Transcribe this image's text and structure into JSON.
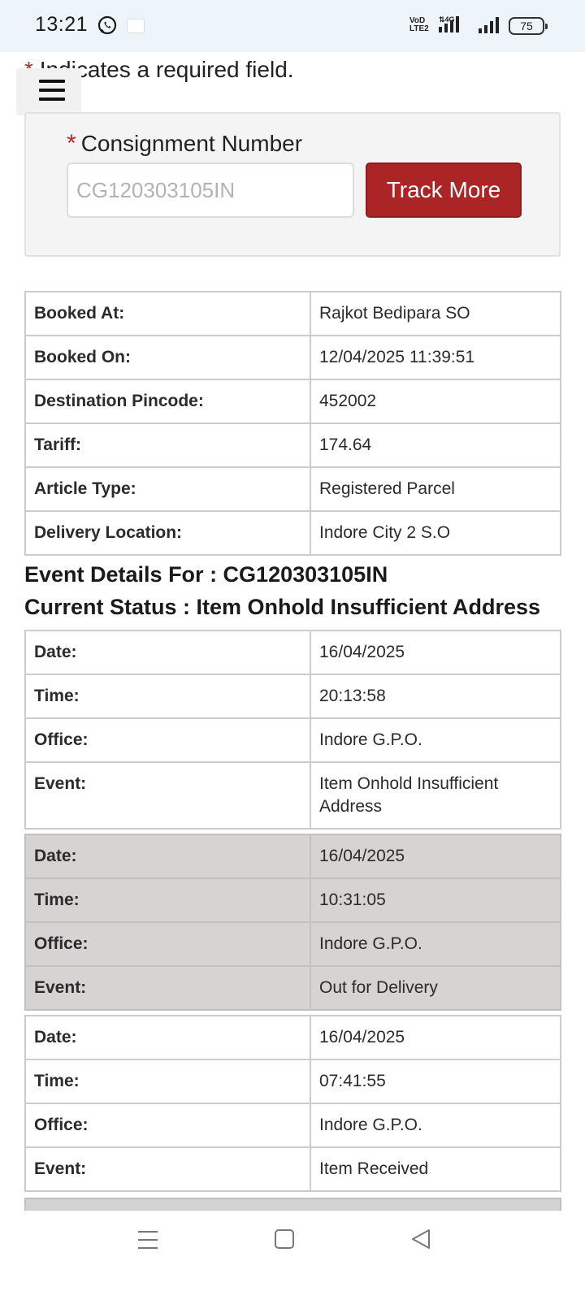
{
  "status_bar": {
    "time": "13:21",
    "network": "VoLTE",
    "battery": "75",
    "icons": [
      "whatsapp-icon",
      "app-notification-icon",
      "volte-icon",
      "4g-signal-icon",
      "signal-icon",
      "battery-icon"
    ]
  },
  "form": {
    "required_star": "*",
    "required_note": "Indicates a required field.",
    "label": "Consignment Number",
    "input_value": "",
    "input_placeholder": "CG120303105IN",
    "button_label": "Track More"
  },
  "booking": {
    "rows": [
      {
        "label": "Booked At:",
        "value": "Rajkot Bedipara SO"
      },
      {
        "label": "Booked On:",
        "value": "12/04/2025 11:39:51"
      },
      {
        "label": "Destination Pincode:",
        "value": "452002"
      },
      {
        "label": "Tariff:",
        "value": "174.64"
      },
      {
        "label": "Article Type:",
        "value": "Registered Parcel"
      },
      {
        "label": "Delivery Location:",
        "value": "Indore City 2 S.O"
      }
    ]
  },
  "events_header": {
    "title": "Event Details For : CG120303105IN",
    "status": "Current Status : Item Onhold Insufficient Address"
  },
  "events": [
    {
      "date_label": "Date:",
      "date": "16/04/2025",
      "time_label": "Time:",
      "time": "20:13:58",
      "office_label": "Office:",
      "office": "Indore G.P.O.",
      "event_label": "Event:",
      "event": "Item Onhold Insufficient Address"
    },
    {
      "date_label": "Date:",
      "date": "16/04/2025",
      "time_label": "Time:",
      "time": "10:31:05",
      "office_label": "Office:",
      "office": "Indore G.P.O.",
      "event_label": "Event:",
      "event": "Out for Delivery"
    },
    {
      "date_label": "Date:",
      "date": "16/04/2025",
      "time_label": "Time:",
      "time": "07:41:55",
      "office_label": "Office:",
      "office": "Indore G.P.O.",
      "event_label": "Event:",
      "event": "Item Received"
    }
  ],
  "colors": {
    "accent": "#ab2426",
    "required": "#b52a2a",
    "shaded_row": "#d6d3d3",
    "status_bar": "#eef5fa"
  },
  "nav_icons": [
    "recents-icon",
    "home-icon",
    "back-icon"
  ]
}
